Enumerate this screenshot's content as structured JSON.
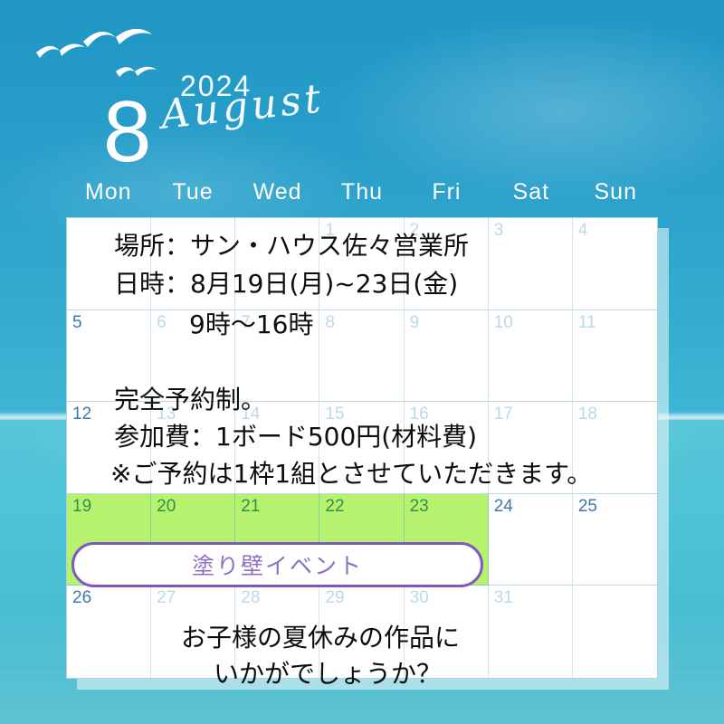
{
  "header": {
    "month_number": "8",
    "year": "2024",
    "month_name": "August"
  },
  "weekdays": [
    "Mon",
    "Tue",
    "Wed",
    "Thu",
    "Fri",
    "Sat",
    "Sun"
  ],
  "calendar": {
    "rows": [
      [
        {
          "day": "",
          "highlight": false,
          "faint": false
        },
        {
          "day": "",
          "highlight": false,
          "faint": false
        },
        {
          "day": "",
          "highlight": false,
          "faint": false
        },
        {
          "day": "1",
          "highlight": false,
          "faint": true
        },
        {
          "day": "2",
          "highlight": false,
          "faint": true
        },
        {
          "day": "3",
          "highlight": false,
          "faint": true
        },
        {
          "day": "4",
          "highlight": false,
          "faint": true
        }
      ],
      [
        {
          "day": "5",
          "highlight": false,
          "faint": false
        },
        {
          "day": "6",
          "highlight": false,
          "faint": true
        },
        {
          "day": "7",
          "highlight": false,
          "faint": true
        },
        {
          "day": "8",
          "highlight": false,
          "faint": true
        },
        {
          "day": "9",
          "highlight": false,
          "faint": true
        },
        {
          "day": "10",
          "highlight": false,
          "faint": true
        },
        {
          "day": "11",
          "highlight": false,
          "faint": true
        }
      ],
      [
        {
          "day": "12",
          "highlight": false,
          "faint": false
        },
        {
          "day": "13",
          "highlight": false,
          "faint": true
        },
        {
          "day": "14",
          "highlight": false,
          "faint": true
        },
        {
          "day": "15",
          "highlight": false,
          "faint": true
        },
        {
          "day": "16",
          "highlight": false,
          "faint": true
        },
        {
          "day": "17",
          "highlight": false,
          "faint": true
        },
        {
          "day": "18",
          "highlight": false,
          "faint": true
        }
      ],
      [
        {
          "day": "19",
          "highlight": true,
          "faint": false
        },
        {
          "day": "20",
          "highlight": true,
          "faint": false
        },
        {
          "day": "21",
          "highlight": true,
          "faint": false
        },
        {
          "day": "22",
          "highlight": true,
          "faint": false
        },
        {
          "day": "23",
          "highlight": true,
          "faint": false
        },
        {
          "day": "24",
          "highlight": false,
          "faint": false
        },
        {
          "day": "25",
          "highlight": false,
          "faint": false
        }
      ],
      [
        {
          "day": "26",
          "highlight": false,
          "faint": false
        },
        {
          "day": "27",
          "highlight": false,
          "faint": true
        },
        {
          "day": "28",
          "highlight": false,
          "faint": true
        },
        {
          "day": "29",
          "highlight": false,
          "faint": true
        },
        {
          "day": "30",
          "highlight": false,
          "faint": true
        },
        {
          "day": "31",
          "highlight": false,
          "faint": true
        },
        {
          "day": "",
          "highlight": false,
          "faint": false
        }
      ]
    ]
  },
  "overlay": {
    "place": "場所：サン・ハウス佐々営業所",
    "datetime": "日時：8月19日(月)~23日(金)",
    "hours": "9時〜16時",
    "reservation": "完全予約制。",
    "fee": "参加費：1ボード500円(材料費)",
    "note": "※ご予約は1枠1組とさせていただきます。",
    "ask_line1": "お子様の夏休みの作品に",
    "ask_line2": "いかがでしょうか？"
  },
  "event": {
    "label": "塗り壁イベント"
  },
  "colors": {
    "sky": "#2aa0cb",
    "sea": "#4ec2d6",
    "highlight_green": "#b6f26d",
    "event_purple": "#8157c0",
    "event_text_purple": "#8f6fc4",
    "date_blue": "#3f78a8",
    "date_faint_blue": "#bcd9e8",
    "highlight_date_green": "#2f8f4e"
  }
}
